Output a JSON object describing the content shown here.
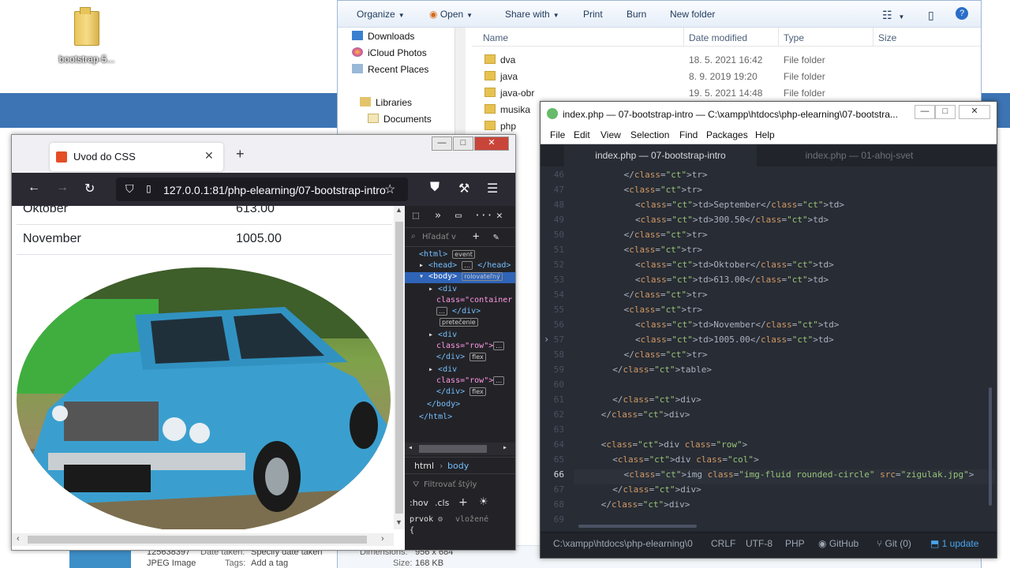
{
  "desktop": {
    "icon_label": "bootstrap-5..."
  },
  "explorer": {
    "toolbar": [
      "Organize",
      "Open",
      "Share with",
      "Print",
      "Burn",
      "New folder"
    ],
    "nav": [
      {
        "label": "Downloads",
        "icon": "download-icon"
      },
      {
        "label": "iCloud Photos",
        "icon": "icloud-icon"
      },
      {
        "label": "Recent Places",
        "icon": "recent-places-icon"
      },
      {
        "label": "Libraries",
        "icon": "libraries-icon"
      },
      {
        "label": "Documents",
        "icon": "documents-icon"
      }
    ],
    "columns": [
      "Name",
      "Date modified",
      "Type",
      "Size"
    ],
    "files": [
      {
        "name": "dva",
        "date": "18. 5. 2021 16:42",
        "type": "File folder"
      },
      {
        "name": "java",
        "date": "8. 9. 2019 19:20",
        "type": "File folder"
      },
      {
        "name": "java-obr",
        "date": "19. 5. 2021 14:48",
        "type": "File folder"
      },
      {
        "name": "musika",
        "date": "",
        "type": ""
      },
      {
        "name": "php",
        "date": "",
        "type": ""
      }
    ],
    "details": {
      "filename": "125638397",
      "date_taken_label": "Date taken:",
      "date_taken": "Specify date taken",
      "type": "JPEG Image",
      "tags_label": "Tags:",
      "tags": "Add a tag",
      "dimensions_label": "Dimensions:",
      "dimensions": "956 x 684",
      "size_label": "Size:",
      "size": "168 KB"
    }
  },
  "firefox": {
    "tab_title": "Uvod do CSS",
    "url": "127.0.0.1:81/php-elearning/07-bootstrap-intro",
    "table": [
      {
        "month": "Oktober",
        "value": "613.00"
      },
      {
        "month": "November",
        "value": "1005.00"
      }
    ],
    "devtools": {
      "search_placeholder": "Hľadať v",
      "lines": [
        {
          "text": "<html>",
          "badge": "event"
        },
        {
          "text": "<head>",
          "badge": "…",
          "tail": "</head>"
        },
        {
          "text": "<body>",
          "badge": "rolovateľný"
        },
        {
          "text": "<div"
        },
        {
          "text": "class=\"container"
        },
        {
          "text": "</div>",
          "badge": "…"
        },
        {
          "text": "",
          "badge": "pretečenie"
        },
        {
          "text": "<div"
        },
        {
          "text": "class=\"row\">",
          "badge": "…"
        },
        {
          "text": "</div>",
          "badge": "flex"
        },
        {
          "text": "<div"
        },
        {
          "text": "class=\"row\">",
          "badge": "…"
        },
        {
          "text": "</div>",
          "badge": "flex"
        },
        {
          "text": "</body>"
        },
        {
          "text": "</html>"
        }
      ],
      "breadcrumb": [
        "html",
        "body"
      ],
      "filter": "Filtrovať štýly",
      "rules": [
        ":hov",
        ".cls"
      ],
      "element_label": "prvok",
      "inline_label": "vložené",
      "brace": "{"
    }
  },
  "atom": {
    "title": "index.php — 07-bootstrap-intro — C:\\xampp\\htdocs\\php-elearning\\07-bootstra...",
    "menu": [
      "File",
      "Edit",
      "View",
      "Selection",
      "Find",
      "Packages",
      "Help"
    ],
    "tabs": [
      "index.php — 07-bootstrap-intro",
      "index.php — 01-ahoj-svet"
    ],
    "lines": [
      {
        "n": "46",
        "code": "</tr>"
      },
      {
        "n": "47",
        "code": "<tr>"
      },
      {
        "n": "48",
        "code": "<td>September</td>"
      },
      {
        "n": "49",
        "code": "<td>300.50</td>"
      },
      {
        "n": "50",
        "code": "</tr>"
      },
      {
        "n": "51",
        "code": "<tr>"
      },
      {
        "n": "52",
        "code": "<td>Oktober</td>"
      },
      {
        "n": "53",
        "code": "<td>613.00</td>"
      },
      {
        "n": "54",
        "code": "</tr>"
      },
      {
        "n": "55",
        "code": "<tr>"
      },
      {
        "n": "56",
        "code": "<td>November</td>"
      },
      {
        "n": "57",
        "code": "<td>1005.00</td>"
      },
      {
        "n": "58",
        "code": "</tr>"
      },
      {
        "n": "59",
        "code": "</table>"
      },
      {
        "n": "60",
        "code": ""
      },
      {
        "n": "61",
        "code": "</div>"
      },
      {
        "n": "62",
        "code": "</div>"
      },
      {
        "n": "63",
        "code": ""
      },
      {
        "n": "64",
        "code": "<div class=\"row\">"
      },
      {
        "n": "65",
        "code": "<div class=\"col\">"
      },
      {
        "n": "66",
        "code": "<img class=\"img-fluid rounded-circle\" src=\"zigulak.jpg\">"
      },
      {
        "n": "67",
        "code": "</div>"
      },
      {
        "n": "68",
        "code": "</div>"
      },
      {
        "n": "69",
        "code": ""
      }
    ],
    "status": {
      "path": "C:\\xampp\\htdocs\\php-elearning\\0",
      "eol": "CRLF",
      "encoding": "UTF-8",
      "grammar": "PHP",
      "github": "GitHub",
      "git": "Git (0)",
      "update": "1 update"
    }
  }
}
